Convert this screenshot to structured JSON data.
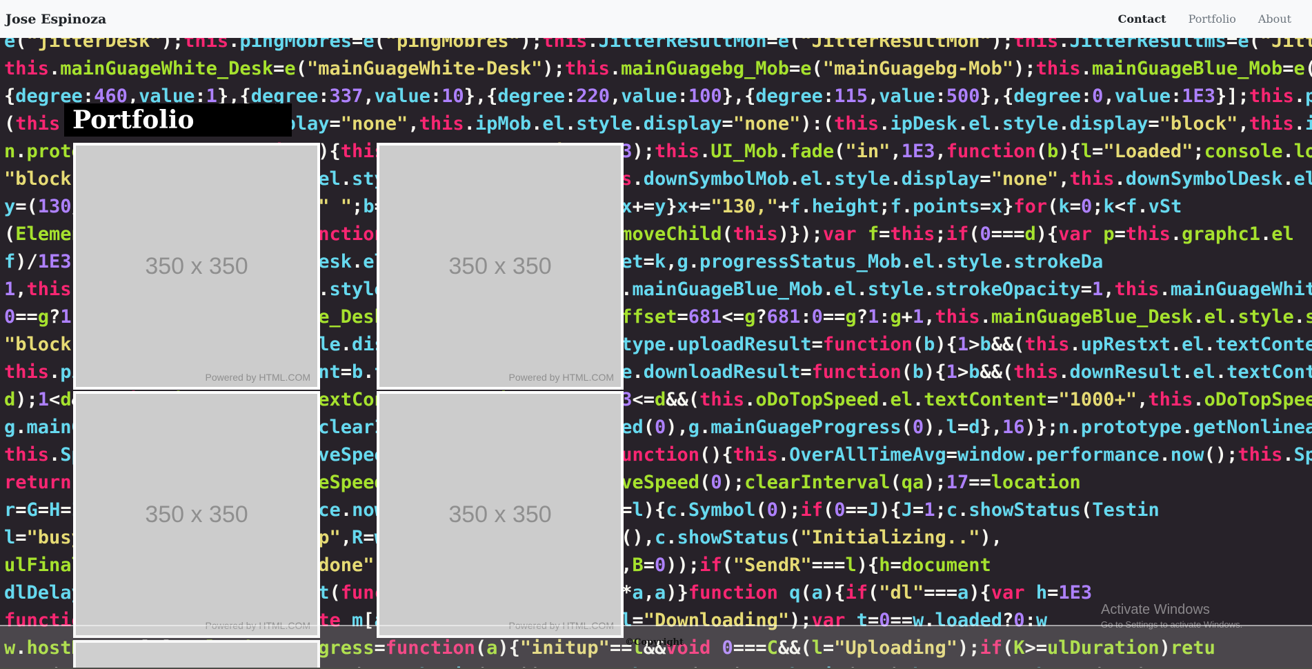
{
  "navbar": {
    "brand": "Jose Espinoza",
    "links": [
      {
        "label": "Contact",
        "active": true
      },
      {
        "label": "Portfolio",
        "active": false
      },
      {
        "label": "About",
        "active": false
      }
    ]
  },
  "portfolio": {
    "heading": "Portfolio",
    "thumbnails": [
      {
        "size_label": "350 x 350",
        "powered_by": "Powered by HTML.COM"
      },
      {
        "size_label": "350 x 350",
        "powered_by": "Powered by HTML.COM"
      },
      {
        "size_label": "350 x 350",
        "powered_by": "Powered by HTML.COM"
      },
      {
        "size_label": "350 x 350",
        "powered_by": "Powered by HTML.COM"
      },
      {
        "size_label": "350 x 350",
        "powered_by": "Powered by HTML.COM"
      },
      {
        "size_label": "350 x 350",
        "powered_by": "Powered by HTML.COM"
      },
      {
        "size_label": "",
        "powered_by": ""
      }
    ]
  },
  "footer": {
    "copyright": "©Copyright"
  },
  "watermark": {
    "title": "Activate Windows",
    "subtitle": "Go to Settings to activate Windows."
  },
  "code_background": {
    "lines": [
      "e(\"jitterDesk\");this.pingMobres=e(\"pingMobres\");this.JitterResultMon=e(\"JitterResultMon\");this.JitterResultms=e(\"JitterResultms\");th",
      "this.mainGuageWhite_Desk=e(\"mainGuageWhite-Desk\");this.mainGuagebg_Mob=e(\"mainGuagebg-Mob\");this.mainGuageBlue_Mob=e(\"mainGuageBlue-",
      "{degree:460,value:1},{degree:337,value:10},{degree:220,value:100},{degree:115,value:500},{degree:0,value:1E3}];this.polygon=this.cha",
      "(this.ipDesk.el.style.display=\"none\",this.ipMob.el.style.display=\"none\"):(this.ipDesk.el.style.display=\"block\",this.ipMob.el.style.d",
      "n.prototype.fadeUI=function(){this.UI_Desk.fade(\"in\",1E3);this.UI_Mob.fade(\"in\",1E3,function(b){l=\"Loaded\";console.log(\"Developed by",
      "\"block\",this.downSymbolDesk.el.style.display=\"none\",this.downSymbolMob.el.style.display=\"none\",this.downSymbolDesk.el.style.d",
      "y=(130/f.height).toFixed(2)+\" \";b=(c*y).toFixed(2)+\" \";x+=y}x+=\"130,\"+f.height;f.points=x}for(k=0;k<f.vSt",
      "(Element.prototype.remove=function(){this.parentNode.removeChild(this)});var f=this;if(0===d){var p=this.graphc1.el",
      "f)/1E3,this.progressStatus_Desk.el.style.strokeDashoffset=k,g.progressStatus_Mob.el.style.strokeDa",
      "1,this.mainGuageBlue_Desk.el.style.strokeOpacity=1,this.mainGuageBlue_Mob.el.style.strokeOpacity=1,this.mainGuageWhite_Mob.el.style",
      "0==g?1:g+1,this.mainGuageBlue_Desk.el.style.strokeDashoffset=681<=g?681:0==g?1:g+1,this.mainGuageBlue_Desk.el.style.strokeDashoffset=681<=g?68",
      "\"block\",this.upResult.el.style.display=\"block\"};n.prototype.uploadResult=function(b){1>b&&(this.upRestxt.el.textContent=b.to",
      "this.pingResult.el.textContent=b.toFixed(0)};n.prototype.downloadResult=function(b){1>b&&(this.downResult.el.textContent=",
      "d);1<d&&(this.LiveSpeed.el.textContent=d.toFixed(0));1E3<=d&&(this.oDoTopSpeed.el.textContent=\"1000+\",this.oDoTopSpeed.el.sty",
      "g.mainGuageProgress(0),0>=q)clearInterval(qa),g.LiveSpeed(0),g.mainGuageProgress(0),l=d},16)};n.prototype.getNonlinearDegree",
      "this.SpeedSamples=[],this.LiveSpeed};n.prototype.init=function(){this.OverAllTimeAvg=window.performance.now();this.SpeedSamples=[]",
      "return a}function v(F){c.LiveSpeed(F)}function d(){c.LiveSpeed(0);clearInterval(qa);17==location",
      "r=G=H=I=0;B=window.performance.now();if(\"Downloading\"===l){c.Symbol(0);if(0==J){J=1;c.showStatus(\"Testin",
      "l=\"busy\",c.upload(),l=\"initup\",R=window.performance.now(),c.showStatus(\"Initializing..\"),",
      "ulFinal=0,c.showStatus(\"All done\"),c.Symbol(2),l=\"busy\",B=0));if(\"SendR\"===l){h=document",
      "dlDelay=ua;var a=0;setTimeout(function(h){x(h)},ulDelay*a,a)}function q(a){if(\"dl\"===a){var h=1E3",
      "function(){m[a].abort(),delete m[a],!1;\"initDown\"==l&&(l=\"Downloading\");var t=0==w.loaded?0:w",
      "w.hostName;u[a].upload.onprogress=function(a){\"initup\"==l&&void 0===C&&(l=\"Uploading\");if(K>=ulDuration)retu",
      "0;L=(a.total-a.loaded)*Math.max(1,Math.min(1,r))/L;M=Math.max(1,M);Math.min(1,r)+b;var a=Math.max(1,r);retu"
    ]
  }
}
